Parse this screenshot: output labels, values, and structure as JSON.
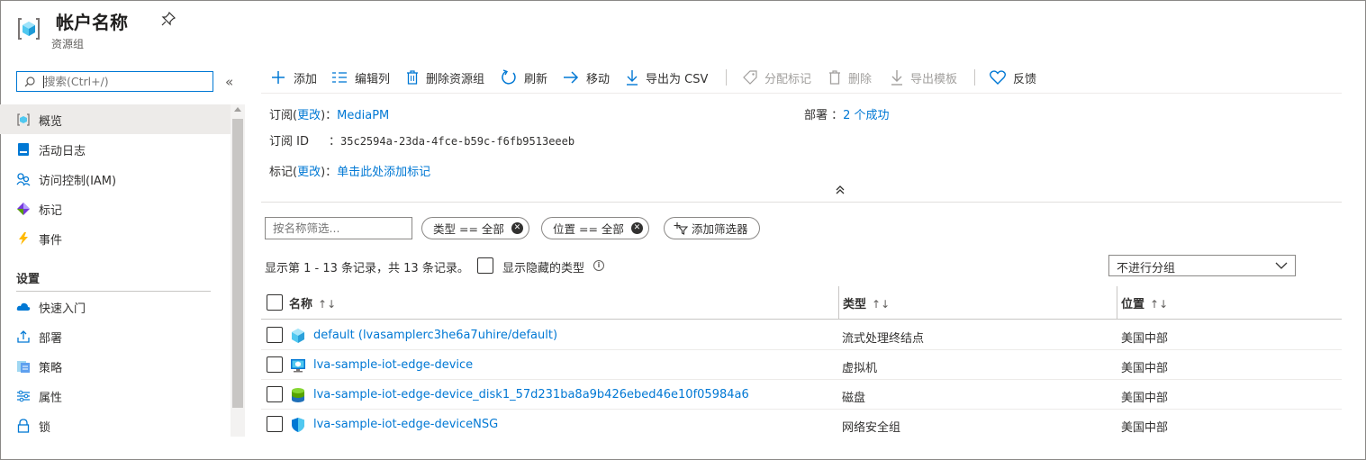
{
  "header": {
    "title": "帐户名称",
    "subtitle": "资源组",
    "icon": "resource-group-icon",
    "pin_icon": "pin-icon"
  },
  "sidebar": {
    "search_placeholder": "搜索(Ctrl+/)",
    "collapse_glyph": "«",
    "items": [
      {
        "label": "概览",
        "icon": "overview-icon",
        "active": true
      },
      {
        "label": "活动日志",
        "icon": "activity-log-icon"
      },
      {
        "label": "访问控制(IAM)",
        "icon": "access-control-icon"
      },
      {
        "label": "标记",
        "icon": "tag-icon"
      },
      {
        "label": "事件",
        "icon": "lightning-icon"
      }
    ],
    "section_label": "设置",
    "settings_items": [
      {
        "label": "快速入门",
        "icon": "quickstart-cloud-icon"
      },
      {
        "label": "部署",
        "icon": "deploy-icon"
      },
      {
        "label": "策略",
        "icon": "policy-icon"
      },
      {
        "label": "属性",
        "icon": "properties-icon"
      },
      {
        "label": "锁",
        "icon": "lock-icon"
      }
    ]
  },
  "toolbar": {
    "add": "添加",
    "edit_columns": "编辑列",
    "delete_group": "删除资源组",
    "refresh": "刷新",
    "move": "移动",
    "export_csv": "导出为 CSV",
    "assign_tags": "分配标记",
    "delete": "删除",
    "export_template": "导出模板",
    "feedback": "反馈"
  },
  "essentials": {
    "subscription_label": "订阅(",
    "change_link": "更改",
    "subscription_suffix": ")：",
    "subscription_value": "MediaPM",
    "subscription_id_label": "订阅 ID",
    "subscription_id_sep": "：",
    "subscription_id": "35c2594a-23da-4fce-b59c-f6fb9513eeeb",
    "tags_label": "标记(",
    "tags_change": "更改",
    "tags_suffix": ")：",
    "tags_value": "单击此处添加标记",
    "deployments_label": "部署 ：",
    "deployments_value": "2 个成功"
  },
  "filters": {
    "name_placeholder": "按名称筛选...",
    "type_pill": "类型 == 全部",
    "location_pill": "位置 == 全部",
    "add_filter": "添加筛选器"
  },
  "listing": {
    "count_text": "显示第 1 - 13 条记录，共 13 条记录。",
    "show_hidden": "显示隐藏的类型",
    "grouping_value": "不进行分组"
  },
  "table": {
    "columns": [
      "名称",
      "类型",
      "位置"
    ],
    "sort_glyph": "↑↓",
    "rows": [
      {
        "name": "default (lvasamplerc3he6a7uhire/default)",
        "type": "流式处理终结点",
        "location": "美国中部",
        "icon": "streaming-endpoint-icon"
      },
      {
        "name": "lva-sample-iot-edge-device",
        "type": "虚拟机",
        "location": "美国中部",
        "icon": "virtual-machine-icon"
      },
      {
        "name": "lva-sample-iot-edge-device_disk1_57d231ba8a9b426ebed46e10f05984a6",
        "type": "磁盘",
        "location": "美国中部",
        "icon": "disk-icon"
      },
      {
        "name": "lva-sample-iot-edge-deviceNSG",
        "type": "网络安全组",
        "location": "美国中部",
        "icon": "network-security-group-icon"
      }
    ]
  },
  "colors": {
    "accent": "#0078d4",
    "text": "#323130",
    "muted": "#605e5c",
    "active_nav": "#edebe9"
  }
}
